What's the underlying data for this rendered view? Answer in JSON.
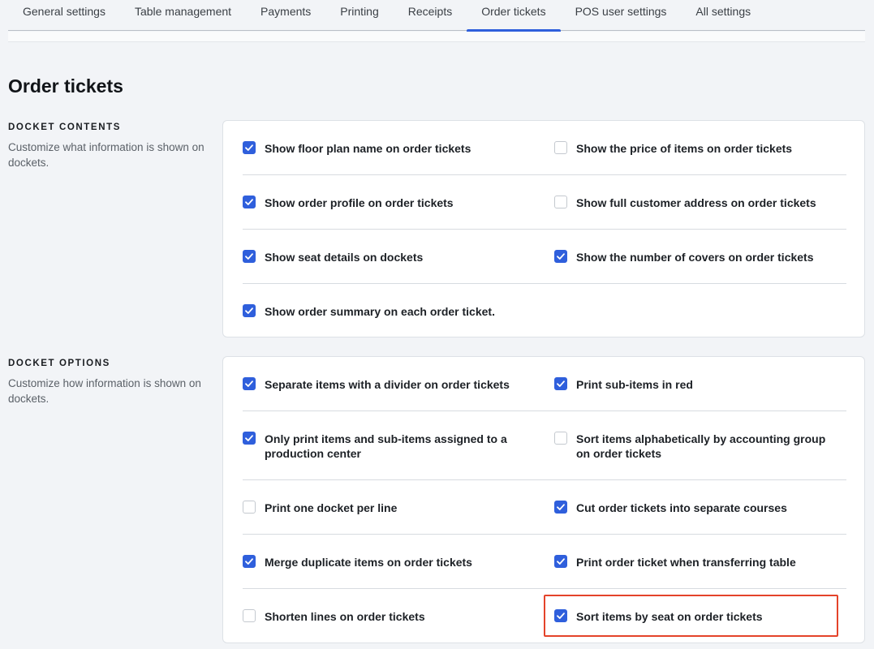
{
  "tabs": [
    {
      "label": "General settings",
      "active": false
    },
    {
      "label": "Table management",
      "active": false
    },
    {
      "label": "Payments",
      "active": false
    },
    {
      "label": "Printing",
      "active": false
    },
    {
      "label": "Receipts",
      "active": false
    },
    {
      "label": "Order tickets",
      "active": true
    },
    {
      "label": "POS user settings",
      "active": false
    },
    {
      "label": "All settings",
      "active": false
    }
  ],
  "page": {
    "title": "Order tickets"
  },
  "docket_contents": {
    "label": "DOCKET CONTENTS",
    "description": "Customize what information is shown on dockets.",
    "options": [
      {
        "label": "Show floor plan name on order tickets",
        "checked": true
      },
      {
        "label": "Show the price of items on order tickets",
        "checked": false
      },
      {
        "label": "Show order profile on order tickets",
        "checked": true
      },
      {
        "label": "Show full customer address on order tickets",
        "checked": false
      },
      {
        "label": "Show seat details on dockets",
        "checked": true
      },
      {
        "label": "Show the number of covers on order tickets",
        "checked": true
      },
      {
        "label": "Show order summary on each order ticket.",
        "checked": true
      }
    ]
  },
  "docket_options": {
    "label": "DOCKET OPTIONS",
    "description": "Customize how information is shown on dockets.",
    "options": [
      {
        "label": "Separate items with a divider on order tickets",
        "checked": true
      },
      {
        "label": "Print sub-items in red",
        "checked": true
      },
      {
        "label": "Only print items and sub-items assigned to a production center",
        "checked": true
      },
      {
        "label": "Sort items alphabetically by accounting group on order tickets",
        "checked": false
      },
      {
        "label": "Print one docket per line",
        "checked": false
      },
      {
        "label": "Cut order tickets into separate courses",
        "checked": true
      },
      {
        "label": "Merge duplicate items on order tickets",
        "checked": true
      },
      {
        "label": "Print order ticket when transferring table",
        "checked": true
      },
      {
        "label": "Shorten lines on order tickets",
        "checked": false
      },
      {
        "label": "Sort items by seat on order tickets",
        "checked": true
      }
    ]
  },
  "colors": {
    "accent": "#2f5fdc",
    "highlight": "#e4432a"
  }
}
